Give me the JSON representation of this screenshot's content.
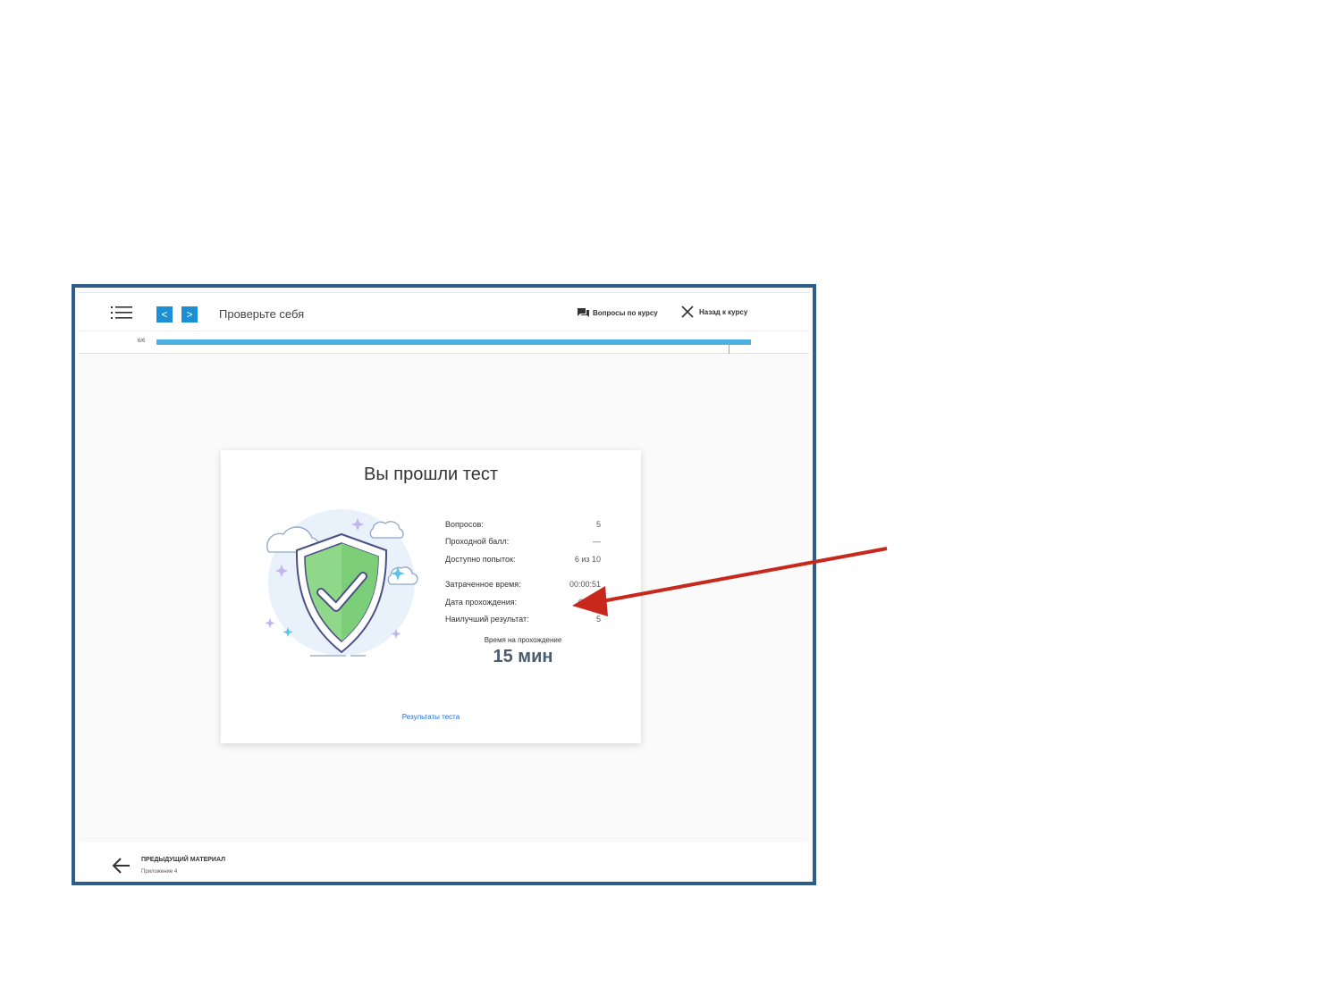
{
  "header": {
    "title": "Проверьте себя",
    "prev_button": "<",
    "next_button": ">",
    "questions_link": "Вопросы по курсу",
    "back_link": "Назад к курсу"
  },
  "progress": {
    "label": "6/6",
    "fraction": 1.0,
    "color": "#49b2e3"
  },
  "result": {
    "title": "Вы прошли тест",
    "stats": [
      {
        "label": "Вопросов:",
        "value": "5"
      },
      {
        "label": "Проходной балл:",
        "value": "—"
      },
      {
        "label": "Доступно попыток:",
        "value": "6 из 10"
      },
      {
        "label": "Затраченное время:",
        "value": "00:00:51"
      },
      {
        "label": "Дата прохождения:",
        "value": "08.05."
      },
      {
        "label": "Наилучший результат:",
        "value": "5"
      }
    ],
    "time_caption": "Время на прохождение",
    "time_value": "15 мин",
    "results_link": "Результаты теста"
  },
  "footer": {
    "prev_material_label": "ПРЕДЫДУЩИЙ МАТЕРИАЛ",
    "prev_material_name": "Приложение 4"
  },
  "icons": {
    "menu": "list-icon",
    "questions": "chat-icon",
    "close": "close-icon",
    "back": "arrow-left-icon",
    "shield": "shield-check-illustration"
  },
  "colors": {
    "frame_border": "#2f5d8a",
    "nav_button": "#1c8fd6",
    "link": "#1c6fd6",
    "annotation_arrow": "#c8281c",
    "shield_green": "#8fd88a"
  }
}
